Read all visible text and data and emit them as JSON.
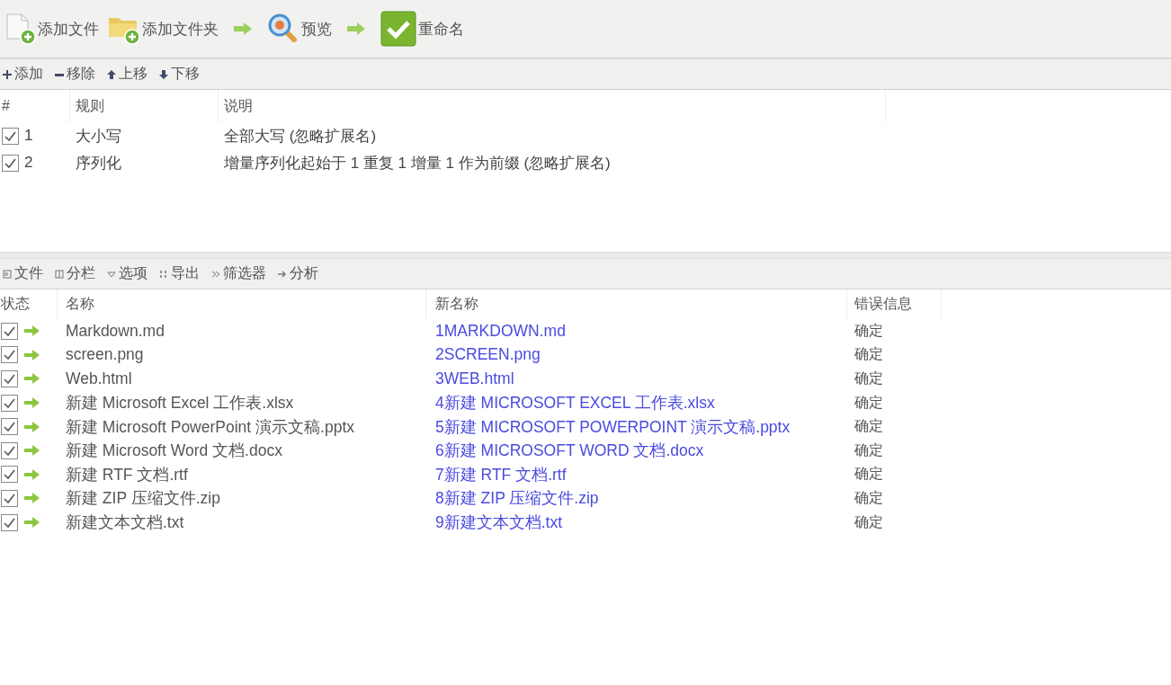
{
  "main_toolbar": [
    {
      "kind": "file-add",
      "label": "添加文件"
    },
    {
      "kind": "folder-add",
      "label": "添加文件夹"
    },
    {
      "kind": "arrow"
    },
    {
      "kind": "preview",
      "label": "预览"
    },
    {
      "kind": "arrow"
    },
    {
      "kind": "rename",
      "label": "重命名"
    }
  ],
  "rules_toolbar": [
    {
      "kind": "plus",
      "label": "添加"
    },
    {
      "kind": "minus",
      "label": "移除"
    },
    {
      "kind": "up",
      "label": "上移"
    },
    {
      "kind": "down",
      "label": "下移"
    }
  ],
  "rules": {
    "columns": [
      "#",
      "规则",
      "说明"
    ],
    "rows": [
      {
        "checked": true,
        "number": "1",
        "rule": "大小写",
        "description": "全部大写 (忽略扩展名)"
      },
      {
        "checked": true,
        "number": "2",
        "rule": "序列化",
        "description": "增量序列化起始于 1 重复 1 增量 1 作为前缀 (忽略扩展名)"
      }
    ]
  },
  "files_toolbar": [
    {
      "kind": "files",
      "label": "文件"
    },
    {
      "kind": "columns",
      "label": "分栏"
    },
    {
      "kind": "options",
      "label": "选项"
    },
    {
      "kind": "export",
      "label": "导出"
    },
    {
      "kind": "filter",
      "label": "筛选器"
    },
    {
      "kind": "analyze",
      "label": "分析"
    }
  ],
  "files": {
    "columns": [
      "状态",
      "名称",
      "新名称",
      "错误信息"
    ],
    "rows": [
      {
        "checked": true,
        "name": "Markdown.md",
        "new_name": "1MARKDOWN.md",
        "error": "确定"
      },
      {
        "checked": true,
        "name": "screen.png",
        "new_name": "2SCREEN.png",
        "error": "确定"
      },
      {
        "checked": true,
        "name": "Web.html",
        "new_name": "3WEB.html",
        "error": "确定"
      },
      {
        "checked": true,
        "name": "新建 Microsoft Excel 工作表.xlsx",
        "new_name": "4新建 MICROSOFT EXCEL 工作表.xlsx",
        "error": "确定"
      },
      {
        "checked": true,
        "name": "新建 Microsoft PowerPoint 演示文稿.pptx",
        "new_name": "5新建 MICROSOFT POWERPOINT 演示文稿.pptx",
        "error": "确定"
      },
      {
        "checked": true,
        "name": "新建 Microsoft Word 文档.docx",
        "new_name": "6新建 MICROSOFT WORD 文档.docx",
        "error": "确定"
      },
      {
        "checked": true,
        "name": "新建 RTF 文档.rtf",
        "new_name": "7新建 RTF 文档.rtf",
        "error": "确定"
      },
      {
        "checked": true,
        "name": "新建 ZIP 压缩文件.zip",
        "new_name": "8新建 ZIP 压缩文件.zip",
        "error": "确定"
      },
      {
        "checked": true,
        "name": "新建文本文档.txt",
        "new_name": "9新建文本文档.txt",
        "error": "确定"
      }
    ]
  }
}
